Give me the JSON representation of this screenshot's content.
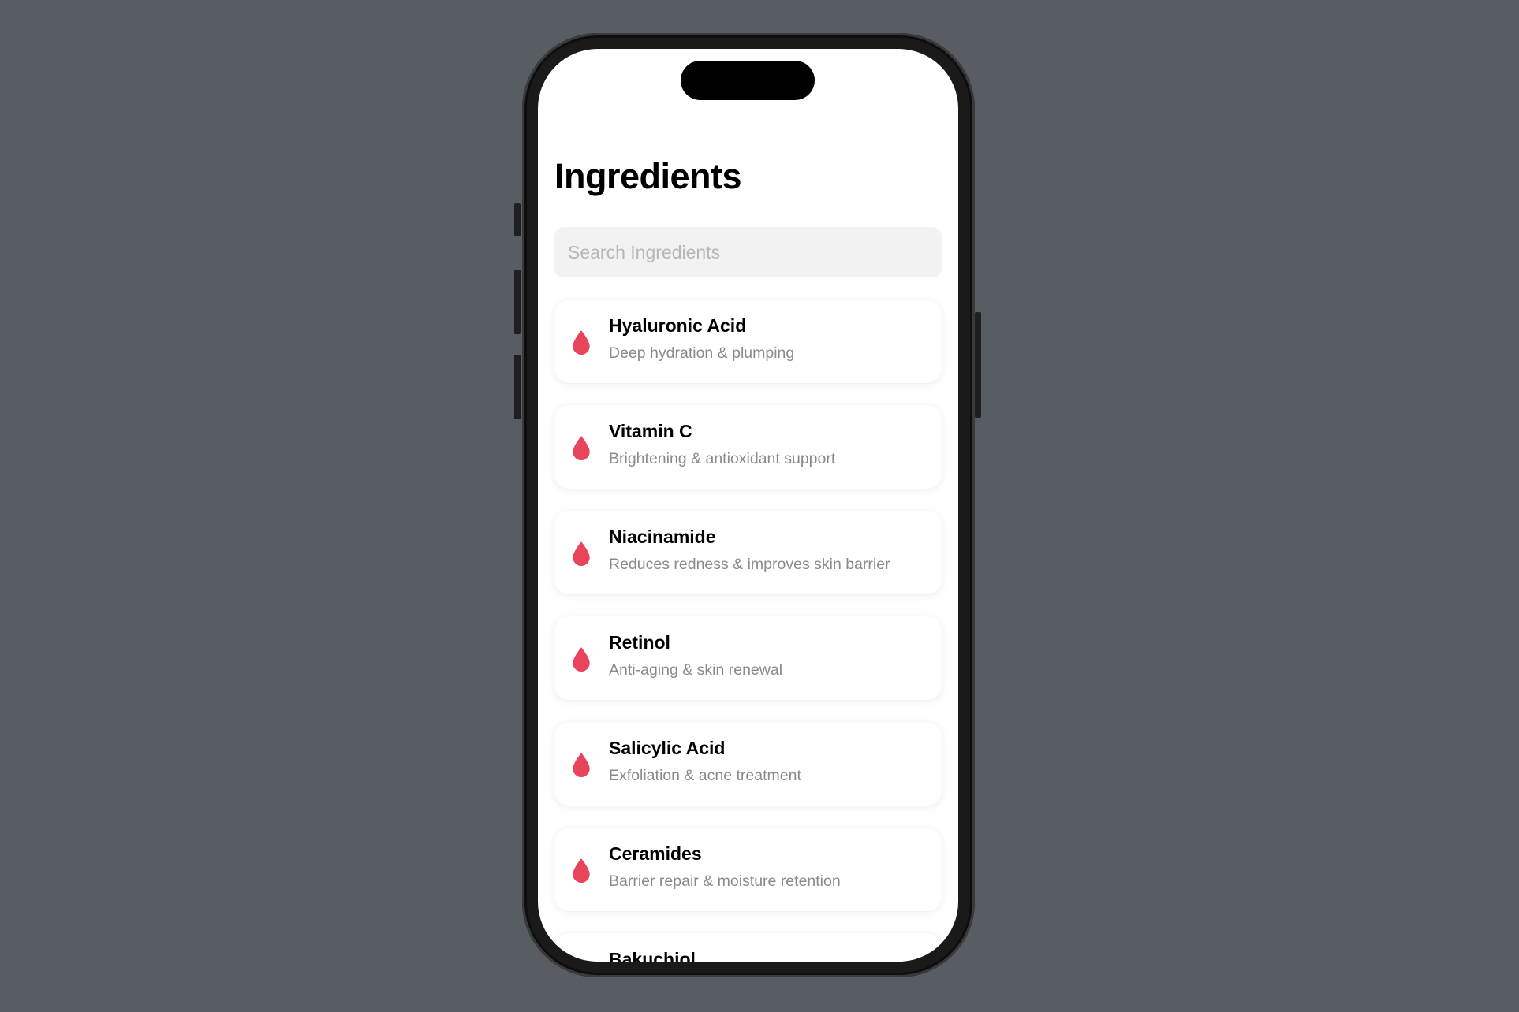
{
  "page": {
    "title": "Ingredients"
  },
  "search": {
    "placeholder": "Search Ingredients",
    "value": ""
  },
  "colors": {
    "background": "#585c63",
    "accent_drop": "#e8445c",
    "secondary_text": "#8a8a8e",
    "search_fill": "#f2f2f3"
  },
  "ingredients": [
    {
      "name": "Hyaluronic Acid",
      "description": "Deep hydration & plumping",
      "icon": "drop-icon"
    },
    {
      "name": "Vitamin C",
      "description": "Brightening & antioxidant support",
      "icon": "drop-icon"
    },
    {
      "name": "Niacinamide",
      "description": "Reduces redness & improves skin barrier",
      "icon": "drop-icon"
    },
    {
      "name": "Retinol",
      "description": "Anti-aging & skin renewal",
      "icon": "drop-icon"
    },
    {
      "name": "Salicylic Acid",
      "description": "Exfoliation & acne treatment",
      "icon": "drop-icon"
    },
    {
      "name": "Ceramides",
      "description": "Barrier repair & moisture retention",
      "icon": "drop-icon"
    },
    {
      "name": "Bakuchiol",
      "description": "",
      "icon": "drop-icon"
    }
  ]
}
